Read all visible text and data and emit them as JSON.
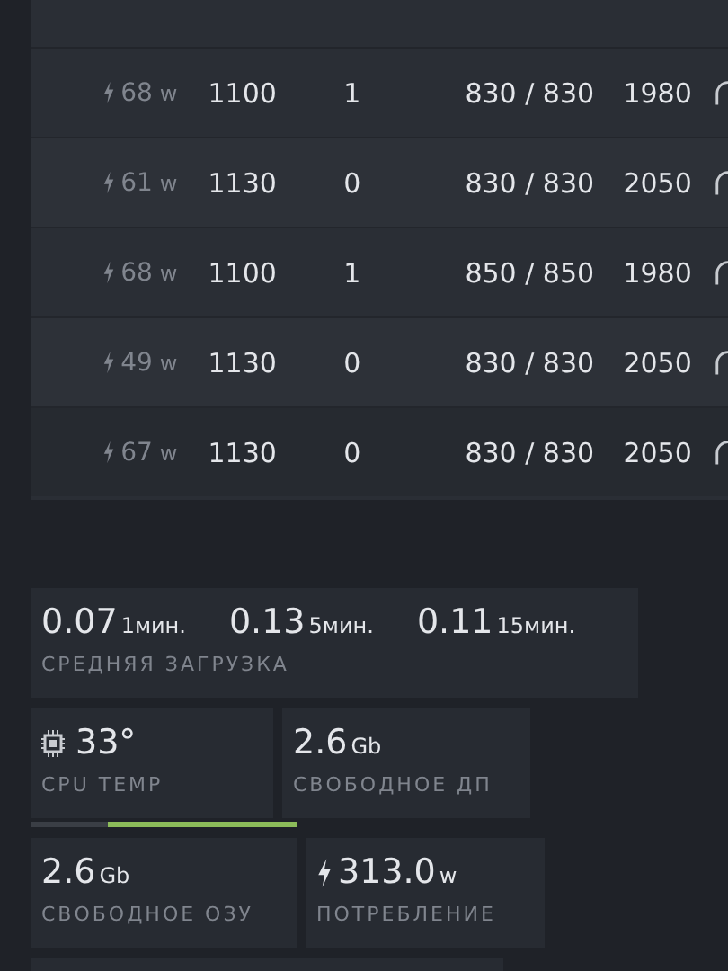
{
  "table": {
    "rows": [
      {
        "power": "68",
        "power_unit": "w",
        "column_2": "1100",
        "column_3": "1",
        "column_4": "830 / 830",
        "column_5": "1980"
      },
      {
        "power": "61",
        "power_unit": "w",
        "column_2": "1130",
        "column_3": "0",
        "column_4": "830 / 830",
        "column_5": "2050"
      },
      {
        "power": "68",
        "power_unit": "w",
        "column_2": "1100",
        "column_3": "1",
        "column_4": "850 / 850",
        "column_5": "1980"
      },
      {
        "power": "49",
        "power_unit": "w",
        "column_2": "1130",
        "column_3": "0",
        "column_4": "830 / 830",
        "column_5": "2050"
      },
      {
        "power": "67",
        "power_unit": "w",
        "column_2": "1130",
        "column_3": "0",
        "column_4": "830 / 830",
        "column_5": "2050"
      }
    ]
  },
  "load_average": {
    "label": "СРЕДНЯЯ ЗАГРУЗКА",
    "values": [
      {
        "value": "0.07",
        "unit": "1мин."
      },
      {
        "value": "0.13",
        "unit": "5мин."
      },
      {
        "value": "0.11",
        "unit": "15мин."
      }
    ]
  },
  "cpu_temp": {
    "value": "33°",
    "label": "CPU TEMP"
  },
  "free_disk": {
    "value": "2.6",
    "unit": "Gb",
    "label": "СВОБОДНОЕ ДП"
  },
  "usage_bar": {
    "level": 0.71
  },
  "free_ram": {
    "value": "2.6",
    "unit": "Gb",
    "label": "СВОБОДНОЕ ОЗУ"
  },
  "consumption": {
    "value": "313.0",
    "unit": "w",
    "label": "ПОТРЕБЛЕНИЕ"
  }
}
